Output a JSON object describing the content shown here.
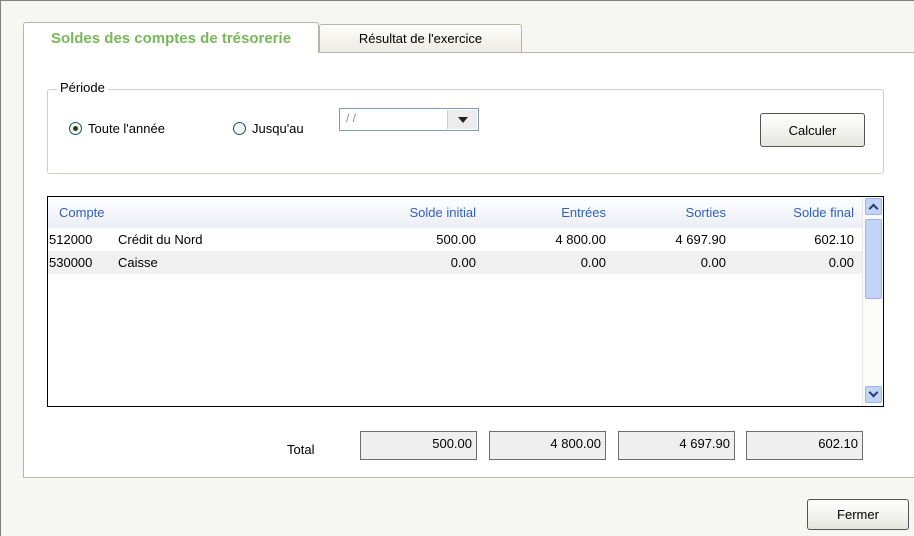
{
  "tabs": [
    {
      "label": "Soldes des comptes de trésorerie",
      "active": true
    },
    {
      "label": "Résultat de l'exercice",
      "active": false
    }
  ],
  "period": {
    "legend": "Période",
    "option_full_year": "Toute l'année",
    "option_until": "Jusqu'au",
    "selected": "full_year",
    "date_value": "/ /"
  },
  "buttons": {
    "calculate": "Calculer",
    "close": "Fermer"
  },
  "grid": {
    "columns": [
      "Compte",
      "Solde initial",
      "Entrées",
      "Sorties",
      "Solde final"
    ],
    "rows": [
      {
        "code": "512000",
        "name": "Crédit du Nord",
        "initial": "500.00",
        "entrees": "4 800.00",
        "sorties": "4 697.90",
        "final": "602.10"
      },
      {
        "code": "530000",
        "name": "Caisse",
        "initial": "0.00",
        "entrees": "0.00",
        "sorties": "0.00",
        "final": "0.00"
      }
    ]
  },
  "totals": {
    "label": "Total",
    "initial": "500.00",
    "entrees": "4 800.00",
    "sorties": "4 697.90",
    "final": "602.10"
  },
  "colors": {
    "active_tab_text": "#78b85a",
    "grid_header_text": "#2f5fc3",
    "scrollbar": "#c2d4f9"
  }
}
